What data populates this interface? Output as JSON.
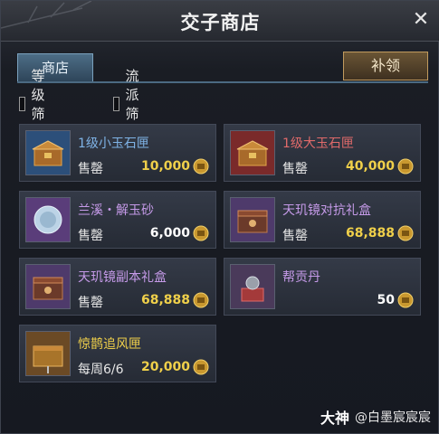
{
  "window": {
    "title": "交子商店",
    "close_icon": "close-icon"
  },
  "tabs": [
    {
      "label": "商店",
      "active": true
    }
  ],
  "supply_button": {
    "label": "补领"
  },
  "filters": [
    {
      "label": "等级筛选",
      "checked": false
    },
    {
      "label": "流派筛选",
      "checked": false
    }
  ],
  "items": [
    {
      "name": "1级小玉石匣",
      "name_color": "#7fb3e6",
      "label": "售罄",
      "price": "10,000",
      "price_color": "#f0d04a",
      "icon": "small-jade-box-icon",
      "icon_bg": "#2c4f7a"
    },
    {
      "name": "1级大玉石匣",
      "name_color": "#e06a6a",
      "label": "售罄",
      "price": "40,000",
      "price_color": "#f0d04a",
      "icon": "large-jade-box-icon",
      "icon_bg": "#7a2a2a"
    },
    {
      "name": "兰溪・解玉砂",
      "name_color": "#c59ae8",
      "label": "售罄",
      "price": "6,000",
      "price_color": "#ffffff",
      "icon": "jade-sand-icon",
      "icon_bg": "#5a3d7a"
    },
    {
      "name": "天玑镜对抗礼盒",
      "name_color": "#c59ae8",
      "label": "售罄",
      "price": "68,888",
      "price_color": "#f0d04a",
      "icon": "pvp-gift-box-icon",
      "icon_bg": "#4e3a6b"
    },
    {
      "name": "天玑镜副本礼盒",
      "name_color": "#c59ae8",
      "label": "售罄",
      "price": "68,888",
      "price_color": "#f0d04a",
      "icon": "dungeon-gift-box-icon",
      "icon_bg": "#4e3a6b"
    },
    {
      "name": "帮贡丹",
      "name_color": "#c59ae8",
      "label": "",
      "price": "50",
      "price_color": "#ffffff",
      "icon": "guild-pill-icon",
      "icon_bg": "#4a3a5a"
    },
    {
      "name": "惊鹊追风匣",
      "name_color": "#f0d04a",
      "label": "每周6/6",
      "price": "20,000",
      "price_color": "#f0d04a",
      "icon": "wind-chaser-box-icon",
      "icon_bg": "#6b4a25"
    }
  ],
  "currency_icon": "coin-icon",
  "watermark": {
    "logo": "大神",
    "text": "@白墨宸宸宸"
  }
}
